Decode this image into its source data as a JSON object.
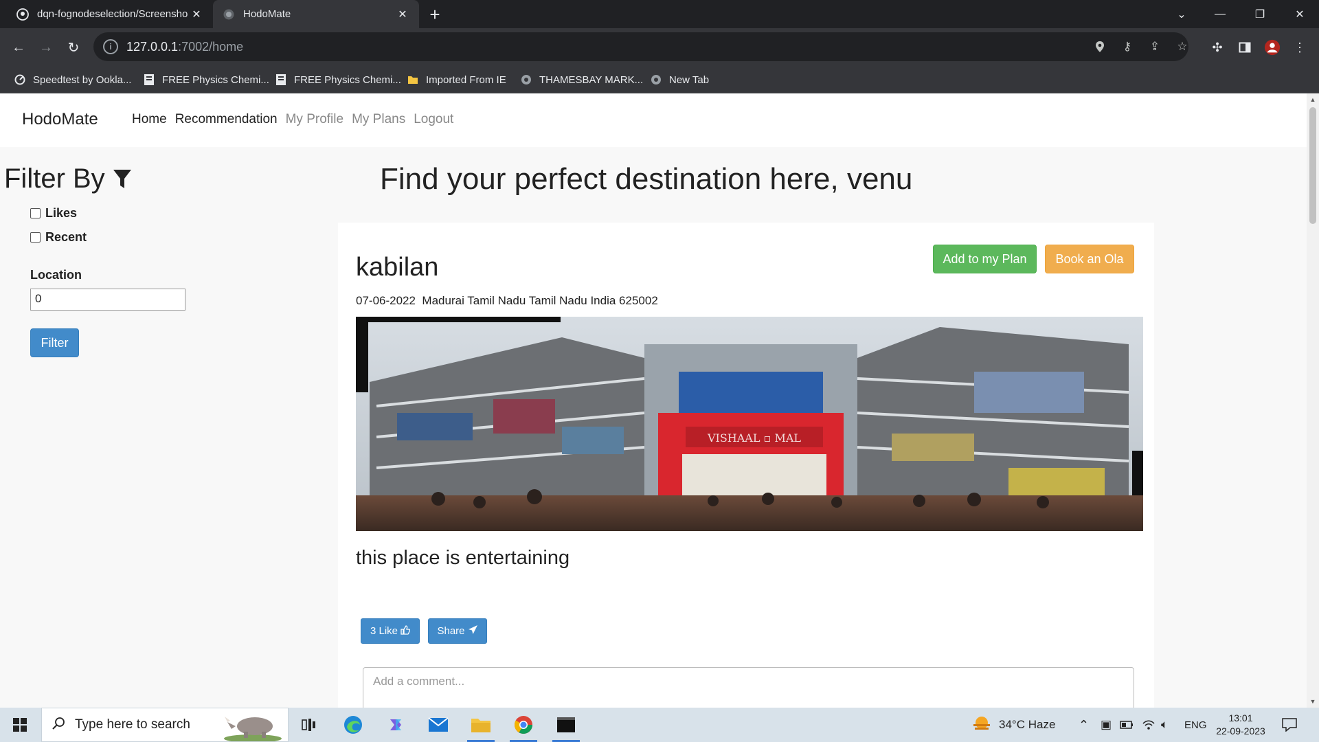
{
  "browser": {
    "tabs": [
      {
        "label": "dqn-fognodeselection/Screensho",
        "active": false
      },
      {
        "label": "HodoMate",
        "active": true
      }
    ],
    "url_host": "127.0.0.1",
    "url_rest": ":7002/home",
    "bookmarks": [
      {
        "label": "Speedtest by Ookla..."
      },
      {
        "label": "FREE Physics Chemi..."
      },
      {
        "label": "FREE Physics Chemi..."
      },
      {
        "label": "Imported From IE"
      },
      {
        "label": "THAMESBAY MARK..."
      },
      {
        "label": "New Tab"
      }
    ]
  },
  "nav": {
    "brand": "HodoMate",
    "links": [
      "Home",
      "Recommendation",
      "My Profile",
      "My Plans",
      "Logout"
    ]
  },
  "filter": {
    "title": "Filter By",
    "options": [
      "Likes",
      "Recent"
    ],
    "location_label": "Location",
    "location_value": "0",
    "button": "Filter"
  },
  "main": {
    "headline": "Find your perfect destination here, venu",
    "post": {
      "name": "kabilan",
      "date": "07-06-2022",
      "address": "Madurai Tamil Nadu Tamil Nadu India 625002",
      "add_plan": "Add to my Plan",
      "book_ola": "Book an Ola",
      "review": "this place is entertaining",
      "likes": "3 Like",
      "share": "Share",
      "comment_placeholder": "Add a comment..."
    }
  },
  "taskbar": {
    "search_placeholder": "Type here to search",
    "weather": "34°C  Haze",
    "lang": "ENG",
    "time": "13:01",
    "date": "22-09-2023"
  },
  "colors": {
    "primary": "#428bca",
    "success": "#5cb85c",
    "warning": "#f0ad4e"
  }
}
